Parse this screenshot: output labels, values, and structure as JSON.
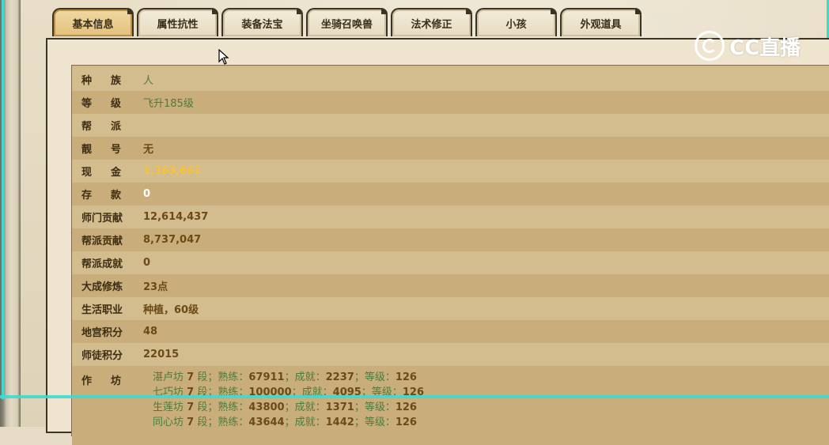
{
  "tabs": [
    {
      "label": "基本信息",
      "active": true
    },
    {
      "label": "属性抗性",
      "active": false
    },
    {
      "label": "装备法宝",
      "active": false
    },
    {
      "label": "坐骑召唤兽",
      "active": false
    },
    {
      "label": "法术修正",
      "active": false
    },
    {
      "label": "小孩",
      "active": false
    },
    {
      "label": "外观道具",
      "active": false
    }
  ],
  "rows": [
    {
      "label": "种族",
      "value": "人",
      "style": "green",
      "spaced": true
    },
    {
      "label": "等级",
      "value": "飞升185级",
      "style": "green",
      "spaced": true
    },
    {
      "label": "帮派",
      "value": "",
      "style": "green",
      "spaced": true
    },
    {
      "label": "靓号",
      "value": "无",
      "style": "normal",
      "spaced": true
    },
    {
      "label": "现金",
      "value": "1,363,661",
      "style": "gold",
      "spaced": true
    },
    {
      "label": "存款",
      "value": "0",
      "style": "white",
      "spaced": true
    },
    {
      "label": "师门贡献",
      "value": "12,614,437",
      "style": "normal",
      "spaced": false
    },
    {
      "label": "帮派贡献",
      "value": "8,737,047",
      "style": "normal",
      "spaced": false
    },
    {
      "label": "帮派成就",
      "value": "0",
      "style": "normal",
      "spaced": false
    },
    {
      "label": "大成修炼",
      "value": "23点",
      "style": "normal",
      "spaced": false
    },
    {
      "label": "生活职业",
      "value": "种植，60级",
      "style": "normal",
      "spaced": false
    },
    {
      "label": "地宫积分",
      "value": "48",
      "style": "normal",
      "spaced": false
    },
    {
      "label": "师徒积分",
      "value": "22015",
      "style": "normal",
      "spaced": false
    }
  ],
  "workshop": {
    "label": "作坊",
    "lines": [
      {
        "name": "湛卢坊",
        "seg": "7",
        "seg_unit": "段；",
        "skill_label": "熟练：",
        "skill": "67911",
        "ach_label": "；成就：",
        "ach": "2237",
        "lvl_label": "；等级：",
        "lvl": "126"
      },
      {
        "name": "七巧坊",
        "seg": "7",
        "seg_unit": "段；",
        "skill_label": "熟练：",
        "skill": "100000",
        "ach_label": "；成就：",
        "ach": "4095",
        "lvl_label": "；等级：",
        "lvl": "126"
      },
      {
        "name": "生莲坊",
        "seg": "7",
        "seg_unit": "段；",
        "skill_label": "熟练：",
        "skill": "43800",
        "ach_label": "；成就：",
        "ach": "1371",
        "lvl_label": "；等级：",
        "lvl": "126"
      },
      {
        "name": "同心坊",
        "seg": "7",
        "seg_unit": "段；",
        "skill_label": "熟练：",
        "skill": "43644",
        "ach_label": "；成就：",
        "ach": "1442",
        "lvl_label": "；等级：",
        "lvl": "126"
      }
    ]
  },
  "watermark": {
    "text": "CC直播",
    "icon": "cc-logo-icon"
  },
  "colors": {
    "teal": "#3fd9cf",
    "gold": "#f4c43d",
    "green": "#4b7b3e",
    "brown": "#6b4a17"
  }
}
